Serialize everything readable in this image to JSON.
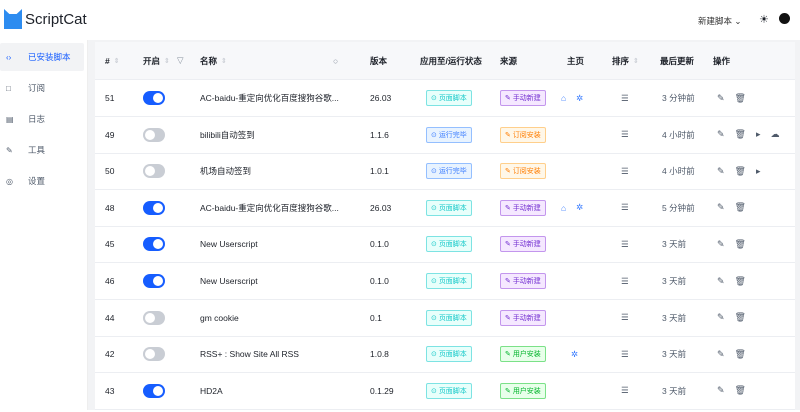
{
  "header": {
    "logo": "ScriptCat",
    "new_script": "新建脚本",
    "theme_icon": "sun-icon",
    "github_icon": "github-icon"
  },
  "sidebar": {
    "items": [
      {
        "label": "已安装脚本",
        "icon": "code-icon",
        "active": true
      },
      {
        "label": "订阅",
        "icon": "bookmark-icon"
      },
      {
        "label": "日志",
        "icon": "log-icon"
      },
      {
        "label": "工具",
        "icon": "tool-icon"
      },
      {
        "label": "设置",
        "icon": "gear-icon"
      }
    ]
  },
  "table": {
    "columns": {
      "id": "#",
      "enabled": "开启",
      "name": "名称",
      "version": "版本",
      "status": "应用至/运行状态",
      "source": "来源",
      "homepage": "主页",
      "order": "排序",
      "updated": "最后更新",
      "actions": "操作"
    },
    "rows": [
      {
        "id": "51",
        "enabled": true,
        "name": "AC-baidu-重定向优化百度搜狗谷歌...",
        "version": "26.03",
        "status": "页面脚本",
        "status_type": "page",
        "source": "手动新建",
        "source_type": "man",
        "home": true,
        "bug": true,
        "updated": "3 分钟前",
        "run": false,
        "cloud": false
      },
      {
        "id": "49",
        "enabled": false,
        "name": "bilibili自动签到",
        "version": "1.1.6",
        "status": "运行完毕",
        "status_type": "run",
        "source": "订阅安装",
        "source_type": "sub",
        "home": false,
        "bug": false,
        "updated": "4 小时前",
        "run": true,
        "cloud": true
      },
      {
        "id": "50",
        "enabled": false,
        "name": "机场自动签到",
        "version": "1.0.1",
        "status": "运行完毕",
        "status_type": "run",
        "source": "订阅安装",
        "source_type": "sub",
        "home": false,
        "bug": false,
        "updated": "4 小时前",
        "run": true,
        "cloud": false
      },
      {
        "id": "48",
        "enabled": true,
        "name": "AC-baidu-重定向优化百度搜狗谷歌...",
        "version": "26.03",
        "status": "页面脚本",
        "status_type": "page",
        "source": "手动新建",
        "source_type": "man",
        "home": true,
        "bug": true,
        "updated": "5 分钟前",
        "run": false,
        "cloud": false
      },
      {
        "id": "45",
        "enabled": true,
        "name": "New Userscript",
        "version": "0.1.0",
        "status": "页面脚本",
        "status_type": "page",
        "source": "手动新建",
        "source_type": "man",
        "home": false,
        "bug": false,
        "updated": "3 天前",
        "run": false,
        "cloud": false
      },
      {
        "id": "46",
        "enabled": true,
        "name": "New Userscript",
        "version": "0.1.0",
        "status": "页面脚本",
        "status_type": "page",
        "source": "手动新建",
        "source_type": "man",
        "home": false,
        "bug": false,
        "updated": "3 天前",
        "run": false,
        "cloud": false
      },
      {
        "id": "44",
        "enabled": false,
        "name": "gm cookie",
        "version": "0.1",
        "status": "页面脚本",
        "status_type": "page",
        "source": "手动新建",
        "source_type": "man",
        "home": false,
        "bug": false,
        "updated": "3 天前",
        "run": false,
        "cloud": false
      },
      {
        "id": "42",
        "enabled": false,
        "name": "RSS+ : Show Site All RSS",
        "version": "1.0.8",
        "status": "页面脚本",
        "status_type": "page",
        "source": "用户安装",
        "source_type": "user",
        "home": false,
        "bug": true,
        "updated": "3 天前",
        "run": false,
        "cloud": false
      },
      {
        "id": "43",
        "enabled": true,
        "name": "HD2A",
        "version": "0.1.29",
        "status": "页面脚本",
        "status_type": "page",
        "source": "用户安装",
        "source_type": "user",
        "home": false,
        "bug": false,
        "updated": "3 天前",
        "run": false,
        "cloud": false
      }
    ]
  }
}
